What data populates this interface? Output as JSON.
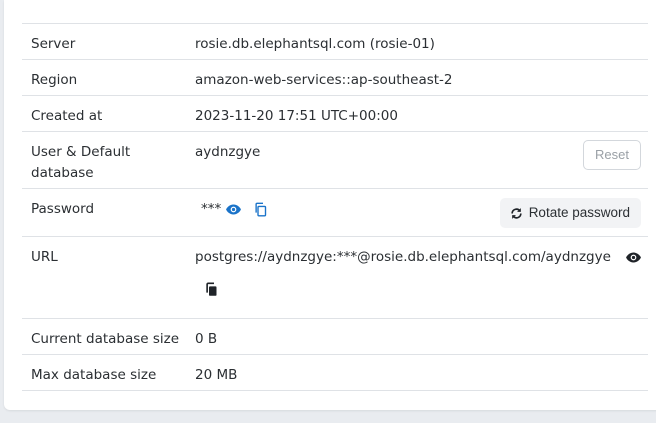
{
  "details": {
    "server": {
      "label": "Server",
      "value": "rosie.db.elephantsql.com (rosie-01)"
    },
    "region": {
      "label": "Region",
      "value": "amazon-web-services::ap-southeast-2"
    },
    "created": {
      "label": "Created at",
      "value": "2023-11-20 17:51 UTC+00:00"
    },
    "user": {
      "label": "User & Default database",
      "value": "aydnzgye",
      "reset_label": "Reset"
    },
    "password": {
      "label": "Password",
      "masked": "***",
      "rotate_label": "Rotate password"
    },
    "url": {
      "label": "URL",
      "value": "postgres://aydnzgye:***@rosie.db.elephantsql.com/aydnzgye"
    },
    "current_size": {
      "label": "Current database size",
      "value": "0 B"
    },
    "max_size": {
      "label": "Max database size",
      "value": "20 MB"
    }
  },
  "icons": {
    "password_show": "eye-icon",
    "password_copy": "copy-icon",
    "rotate": "refresh-icon",
    "url_show": "eye-icon",
    "url_copy": "copy-icon"
  },
  "colors": {
    "accent_blue": "#1a73c9",
    "dark_icon": "#1f2328",
    "border": "#dfe2e6"
  }
}
